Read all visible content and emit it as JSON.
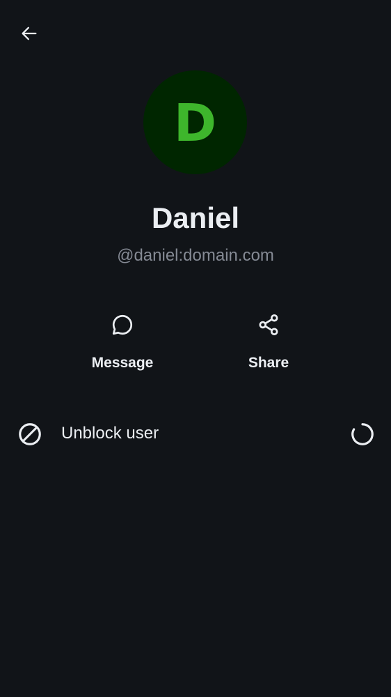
{
  "header": {
    "back_icon": "arrow-left-icon"
  },
  "profile": {
    "avatar_initial": "D",
    "avatar_bg_color": "#002600",
    "avatar_text_color": "#3eb62c",
    "display_name": "Daniel",
    "user_id": "@daniel:domain.com"
  },
  "actions": [
    {
      "label": "Message",
      "icon": "chat-bubble-icon"
    },
    {
      "label": "Share",
      "icon": "share-icon"
    }
  ],
  "settings": {
    "unblock_label": "Unblock user",
    "unblock_icon": "block-icon",
    "status_icon": "loading-spinner-icon"
  },
  "colors": {
    "background": "#111418",
    "primary_text": "#ebeef2",
    "secondary_text": "#858a94"
  }
}
